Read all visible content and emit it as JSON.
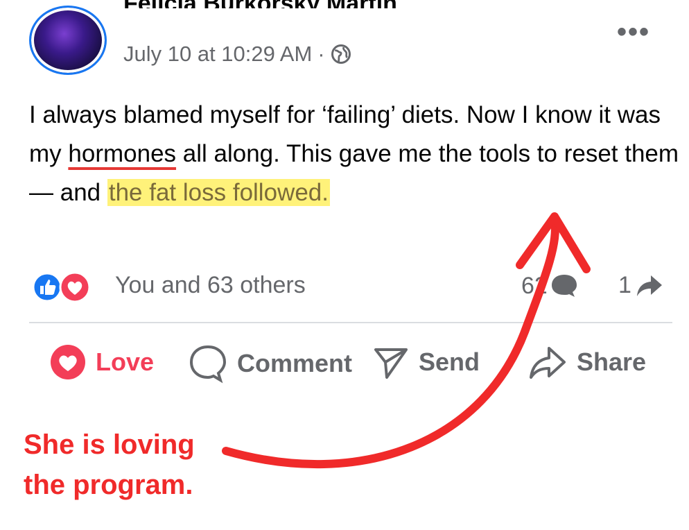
{
  "post": {
    "author": "Felicia Burkorsky Martin",
    "timestamp": "July 10 at 10:29 AM",
    "separator": "·",
    "text_part1": "I always blamed myself for ‘failing’ diets. Now I know it was my ",
    "text_underlined": "hormones",
    "text_part2": " all along. This gave me the tools to reset them — and ",
    "text_highlighted": "the fat loss followed.",
    "more_label": "•••"
  },
  "stats": {
    "reactions_summary": "You and 63 others",
    "comment_count": "62",
    "share_count": "1"
  },
  "actions": {
    "love": "Love",
    "comment": "Comment",
    "send": "Send",
    "share": "Share"
  },
  "annotation": {
    "line1": "She is loving",
    "line2": "the program."
  },
  "colors": {
    "facebook_blue": "#1877f2",
    "love_red": "#f33e58",
    "annotation_red": "#f02a2a",
    "highlight_yellow": "#fff27a"
  }
}
